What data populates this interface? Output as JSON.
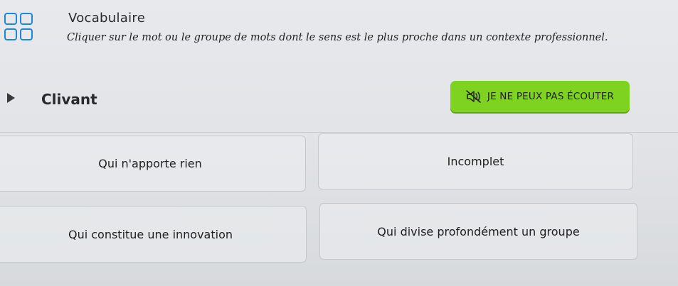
{
  "header": {
    "title": "Vocabulaire",
    "instruction": "Cliquer sur le mot ou le groupe de mots dont le sens est le plus proche dans un contexte professionnel.",
    "icon": "grid-icon",
    "icon_color": "#1e88d8"
  },
  "prompt": {
    "play_icon": "play-icon",
    "word": "Clivant"
  },
  "cant_listen": {
    "label": "JE NE PEUX PAS ÉCOUTER",
    "icon": "mute-speaker-icon",
    "color": "#7ed321"
  },
  "options": [
    {
      "label": "Qui n'apporte rien"
    },
    {
      "label": "Incomplet"
    },
    {
      "label": "Qui constitue une innovation"
    },
    {
      "label": "Qui divise profondément un groupe"
    }
  ]
}
